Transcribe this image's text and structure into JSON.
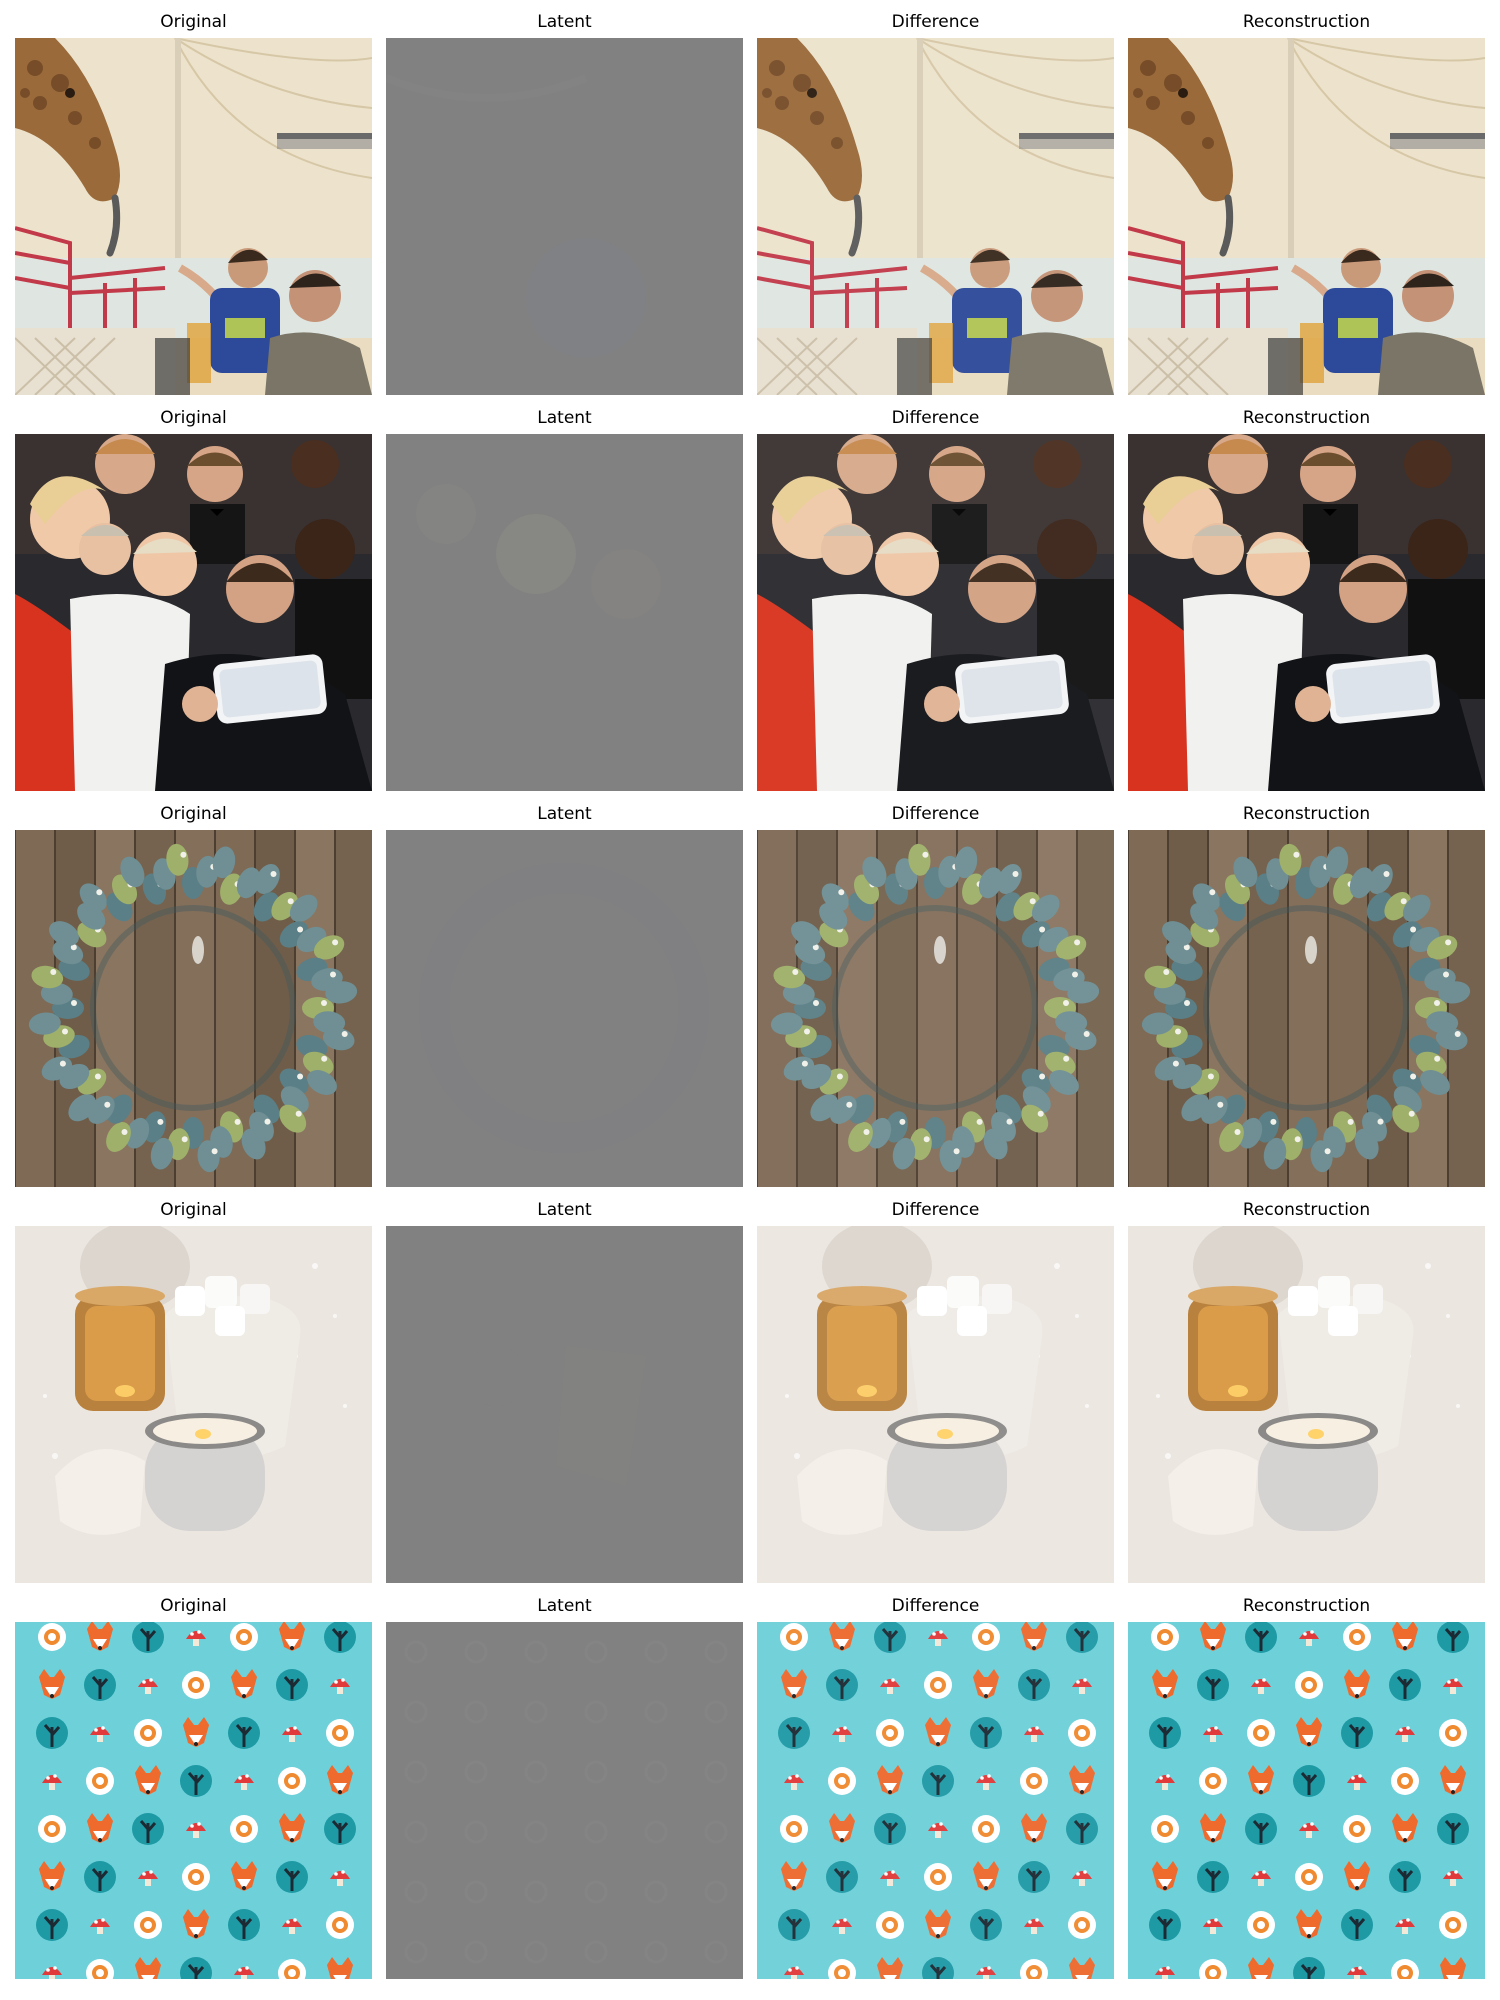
{
  "columns": [
    {
      "key": "original",
      "label": "Original"
    },
    {
      "key": "latent",
      "label": "Latent"
    },
    {
      "key": "difference",
      "label": "Difference"
    },
    {
      "key": "reconstruction",
      "label": "Reconstruction"
    }
  ],
  "rows": [
    {
      "subject": "giraffe-tent"
    },
    {
      "subject": "group-selfie"
    },
    {
      "subject": "eucalyptus-wreath"
    },
    {
      "subject": "candles-marshmallows"
    },
    {
      "subject": "fox-flower-pattern"
    }
  ],
  "colors": {
    "latent_gray": "#818181",
    "tent_cream": "#e9dcc0",
    "giraffe_brown": "#9a6a3a",
    "fence_red": "#c23a4a",
    "shirt_blue": "#2d4a9a",
    "dress_red": "#d8331f",
    "wood_brown": "#7e6a55",
    "leaf_teal": "#6f8f94",
    "pattern_aqua": "#6ed0d9",
    "fox_orange": "#ee6a2d",
    "tree_teal": "#1e9aa5"
  }
}
